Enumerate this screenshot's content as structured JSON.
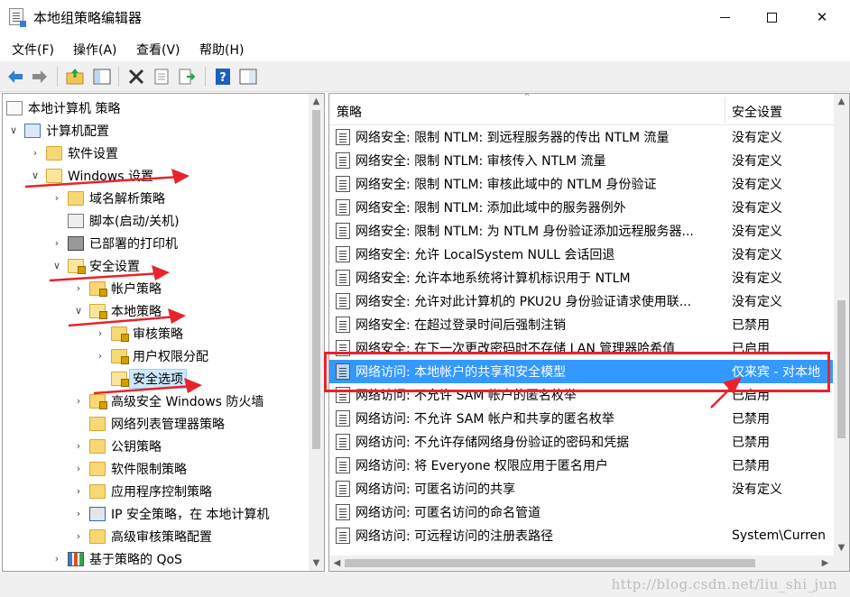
{
  "window": {
    "title": "本地组策略编辑器",
    "icon": "policy-editor-icon"
  },
  "menu": [
    "文件(F)",
    "操作(A)",
    "查看(V)",
    "帮助(H)"
  ],
  "toolbar": {
    "buttons": [
      "back-icon",
      "forward-icon",
      "up-folder-icon",
      "show-hide-tree-icon",
      "delete-icon",
      "properties-icon",
      "export-icon",
      "help-icon",
      "extended-view-icon"
    ]
  },
  "tree": {
    "items": [
      {
        "label": "本地计算机 策略",
        "icon": "policy-book-icon",
        "expander": ""
      },
      {
        "label": "计算机配置",
        "icon": "computer-icon",
        "expander": "∨"
      },
      {
        "label": "软件设置",
        "icon": "folder-icon",
        "expander": "›"
      },
      {
        "label": "Windows 设置",
        "icon": "folder-open-icon",
        "expander": "∨"
      },
      {
        "label": "域名解析策略",
        "icon": "folder-icon",
        "expander": "›"
      },
      {
        "label": "脚本(启动/关机)",
        "icon": "script-icon",
        "expander": ""
      },
      {
        "label": "已部署的打印机",
        "icon": "printer-icon",
        "expander": "›"
      },
      {
        "label": "安全设置",
        "icon": "security-folder-icon",
        "expander": "∨"
      },
      {
        "label": "帐户策略",
        "icon": "security-folder-icon",
        "expander": "›"
      },
      {
        "label": "本地策略",
        "icon": "security-folder-icon",
        "expander": "∨"
      },
      {
        "label": "审核策略",
        "icon": "security-folder-icon",
        "expander": "›"
      },
      {
        "label": "用户权限分配",
        "icon": "security-folder-icon",
        "expander": "›"
      },
      {
        "label": "安全选项",
        "icon": "security-folder-icon",
        "expander": ""
      },
      {
        "label": "高级安全 Windows 防火墙",
        "icon": "security-folder-icon",
        "expander": "›"
      },
      {
        "label": "网络列表管理器策略",
        "icon": "folder-icon",
        "expander": ""
      },
      {
        "label": "公钥策略",
        "icon": "folder-icon",
        "expander": "›"
      },
      {
        "label": "软件限制策略",
        "icon": "folder-icon",
        "expander": "›"
      },
      {
        "label": "应用程序控制策略",
        "icon": "folder-icon",
        "expander": "›"
      },
      {
        "label": "IP 安全策略，在 本地计算机",
        "icon": "ipsec-icon",
        "expander": "›"
      },
      {
        "label": "高级审核策略配置",
        "icon": "folder-icon",
        "expander": "›"
      },
      {
        "label": "基于策略的 QoS",
        "icon": "qos-chart-icon",
        "expander": "›"
      }
    ]
  },
  "list": {
    "columns": [
      "策略",
      "安全设置"
    ],
    "rows": [
      {
        "policy": "网络安全: 限制 NTLM: 到远程服务器的传出 NTLM 流量",
        "setting": "没有定义"
      },
      {
        "policy": "网络安全: 限制 NTLM: 审核传入 NTLM 流量",
        "setting": "没有定义"
      },
      {
        "policy": "网络安全: 限制 NTLM: 审核此域中的 NTLM 身份验证",
        "setting": "没有定义"
      },
      {
        "policy": "网络安全: 限制 NTLM: 添加此域中的服务器例外",
        "setting": "没有定义"
      },
      {
        "policy": "网络安全: 限制 NTLM: 为 NTLM 身份验证添加远程服务器...",
        "setting": "没有定义"
      },
      {
        "policy": "网络安全: 允许 LocalSystem NULL 会话回退",
        "setting": "没有定义"
      },
      {
        "policy": "网络安全: 允许本地系统将计算机标识用于 NTLM",
        "setting": "没有定义"
      },
      {
        "policy": "网络安全: 允许对此计算机的 PKU2U 身份验证请求使用联...",
        "setting": "没有定义"
      },
      {
        "policy": "网络安全: 在超过登录时间后强制注销",
        "setting": "已禁用"
      },
      {
        "policy": "网络安全: 在下一次更改密码时不存储 LAN 管理器哈希值",
        "setting": "已启用"
      },
      {
        "policy": "网络访问: 本地帐户的共享和安全模型",
        "setting": "仅来宾 - 对本地"
      },
      {
        "policy": "网络访问: 不允许 SAM 帐户的匿名枚举",
        "setting": "已启用"
      },
      {
        "policy": "网络访问: 不允许 SAM 帐户和共享的匿名枚举",
        "setting": "已禁用"
      },
      {
        "policy": "网络访问: 不允许存储网络身份验证的密码和凭据",
        "setting": "已禁用"
      },
      {
        "policy": "网络访问: 将 Everyone 权限应用于匿名用户",
        "setting": "已禁用"
      },
      {
        "policy": "网络访问: 可匿名访问的共享",
        "setting": "没有定义"
      },
      {
        "policy": "网络访问: 可匿名访问的命名管道",
        "setting": ""
      },
      {
        "policy": "网络访问: 可远程访问的注册表路径",
        "setting": "System\\Curren"
      }
    ]
  },
  "watermark": "http://blog.csdn.net/liu_shi_jun",
  "colors": {
    "selection": "#3399ff",
    "annotation": "#e8232a",
    "tree_selection": "#cce8ff"
  }
}
